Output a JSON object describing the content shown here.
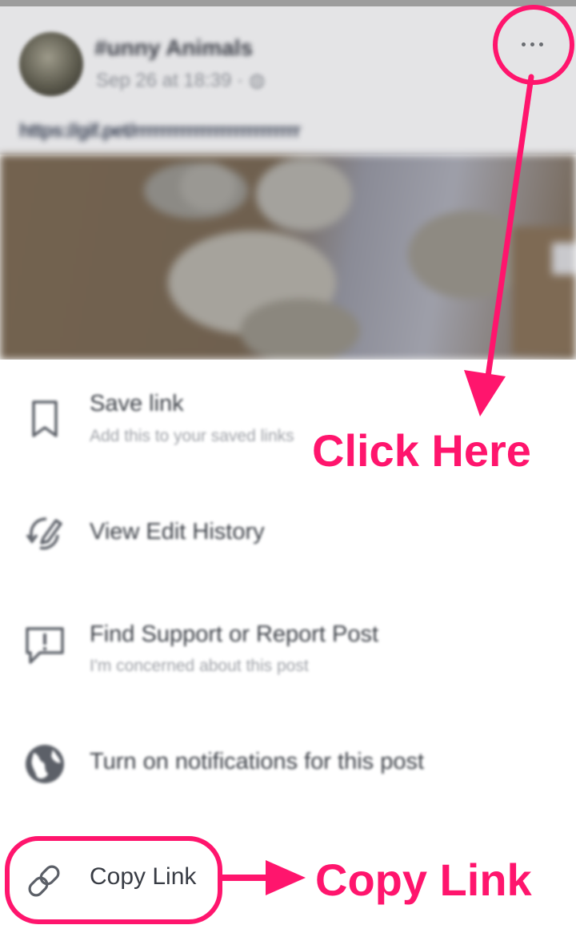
{
  "post": {
    "author": "#unny Animals",
    "meta": "Sep 26 at 18:39 · ",
    "link_text": "https://gif.pet/rrrrrrrrrrrrrrrrrrrrrrrrr",
    "more_glyph": "···"
  },
  "menu": {
    "items": [
      {
        "label": "Save link",
        "sub": "Add this to your saved links",
        "icon": "bookmark-icon"
      },
      {
        "label": "View Edit History",
        "icon": "edit-history-icon"
      },
      {
        "label": "Find Support or Report Post",
        "sub": "I'm concerned about this post",
        "icon": "report-icon"
      },
      {
        "label": "Turn on notifications for this post",
        "icon": "globe-icon"
      },
      {
        "label": "Copy Link",
        "icon": "link-icon"
      }
    ]
  },
  "annotations": {
    "click_here": "Click Here",
    "copy_link": "Copy Link",
    "color": "#ff156d"
  }
}
